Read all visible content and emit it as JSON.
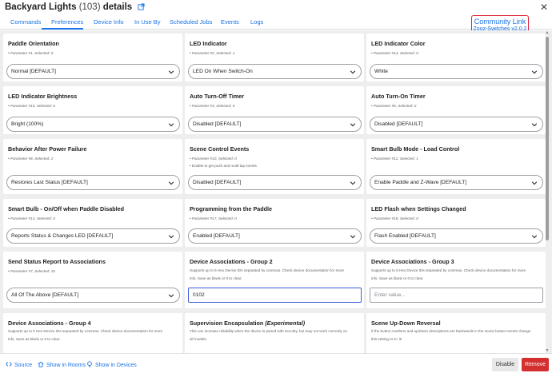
{
  "header": {
    "name": "Backyard Lights",
    "count": "(103)",
    "suffix": "details",
    "close": "✕"
  },
  "tabs": [
    {
      "label": "Commands"
    },
    {
      "label": "Preferences"
    },
    {
      "label": "Device Info"
    },
    {
      "label": "In Use By"
    },
    {
      "label": "Scheduled Jobs"
    },
    {
      "label": "Events"
    },
    {
      "label": "Logs"
    }
  ],
  "community": {
    "heading": "Community Link",
    "version": "Zooz-Switches v2.0.2"
  },
  "cards": [
    {
      "title": "Paddle Orientation",
      "param": "• Parameter #1, Selected: 0",
      "value": "Normal [DEFAULT]"
    },
    {
      "title": "LED Indicator",
      "param": "• Parameter #2, Selected: 1",
      "value": "LED On When Switch-On"
    },
    {
      "title": "LED Indicator Color",
      "param": "• Parameter #14, Selected: 0",
      "value": "White"
    },
    {
      "title": "LED Indicator Brightness",
      "param": "• Parameter #15, Selected: 0",
      "value": "Bright (100%)"
    },
    {
      "title": "Auto Turn-Off Timer",
      "param": "• Parameter #3, Selected: 0",
      "value": "Disabled [DEFAULT]"
    },
    {
      "title": "Auto Turn-On Timer",
      "param": "• Parameter #5, Selected: 0",
      "value": "Disabled [DEFAULT]"
    },
    {
      "title": "Behavior After Power Failure",
      "param": "• Parameter #8, Selected: 2",
      "value": "Restores Last Status [DEFAULT]"
    },
    {
      "title": "Scene Control Events",
      "param": "• Parameter #10, Selected: 0",
      "desc": "• Enable to get push and multi-tap events",
      "value": "Disabled [DEFAULT]"
    },
    {
      "title": "Smart Bulb Mode - Load Control",
      "param": "• Parameter #12, Selected: 1",
      "value": "Enable Paddle and Z-Wave [DEFAULT]"
    },
    {
      "title": "Smart Bulb - On/Off when Paddle Disabled",
      "param": "• Parameter #13, Selected: 0",
      "value": "Reports Status & Changes LED [DEFAULT]"
    },
    {
      "title": "Programming from the Paddle",
      "param": "• Parameter #17, Selected: 0",
      "value": "Enabled [DEFAULT]"
    },
    {
      "title": "LED Flash when Settings Changed",
      "param": "• Parameter #18, Selected: 0",
      "value": "Flash Enabled [DEFAULT]"
    },
    {
      "title": "Send Status Report to Associations",
      "param": "• Parameter #7, Selected: 15",
      "value": "All Of The Above [DEFAULT]"
    },
    {
      "title": "Device Associations - Group 2",
      "desc": "Supports up to 5 Hex Device IDs separated by commas. Check device documentation for more info. Save as blank or 0 to clear.",
      "value": "0102"
    },
    {
      "title": "Device Associations - Group 3",
      "desc": "Supports up to 5 Hex Device IDs separated by commas. Check device documentation for more info. Save as blank or 0 to clear.",
      "placeholder": "Enter value..."
    },
    {
      "title": "Device Associations - Group 4",
      "desc": "Supports up to 5 Hex Device IDs separated by commas. Check device documentation for more info. Save as blank or 0 to clear."
    },
    {
      "title": "Supervision Encapsulation",
      "title_em": "(Experimental)",
      "desc": "This can increase reliability when the device is paired with security, but may not work correctly on all models."
    },
    {
      "title": "Scene Up-Down Reversal",
      "desc": "If the button numbers and up/down descriptions are backwards in the scene button events change this setting to 5+ it!"
    }
  ],
  "footer": {
    "source": "Source",
    "rooms": "Show in Rooms",
    "devices": "Show in Devices",
    "disable": "Disable",
    "remove": "Remove"
  },
  "colors": {
    "accent": "#1a73e8",
    "remove": "#d32f2f",
    "community_border": "#e0203c",
    "focus": "#3b5bdb"
  }
}
